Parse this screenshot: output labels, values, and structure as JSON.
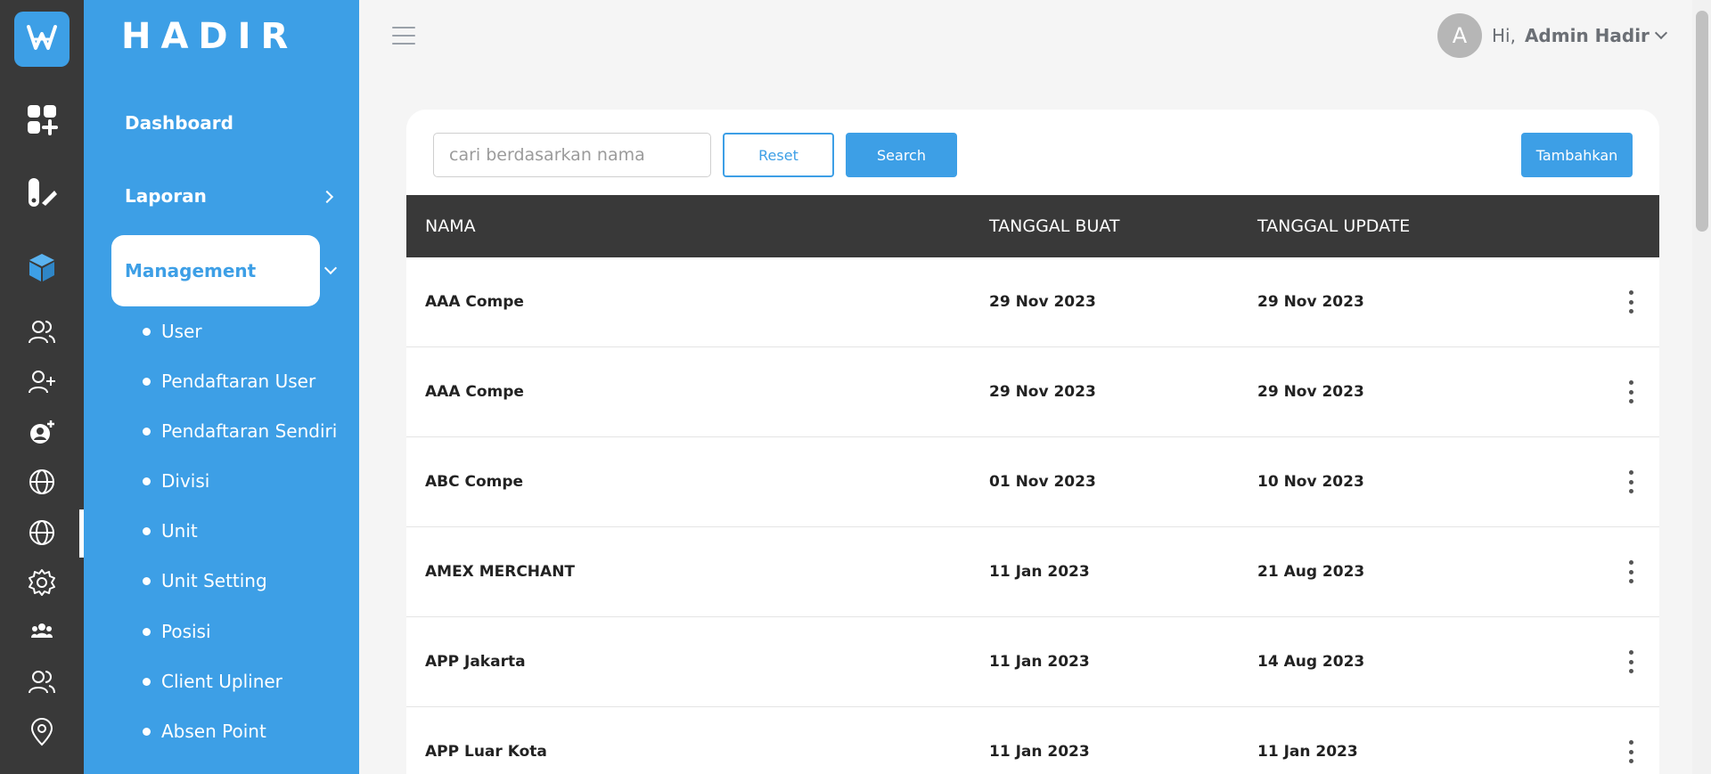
{
  "app": {
    "brand": "HADIR"
  },
  "sidebar": {
    "rail_icons": [
      "dashboard-icon",
      "report-icon",
      "cube-icon",
      "users-icon",
      "user-add-icon",
      "user-settings-icon",
      "globe-icon",
      "globe-icon",
      "gear-icon",
      "team-icon",
      "users-icon",
      "location-pin-icon"
    ],
    "menu": {
      "dashboard": "Dashboard",
      "laporan": "Laporan",
      "management": "Management",
      "sub_items": [
        "User",
        "Pendaftaran User",
        "Pendaftaran Sendiri",
        "Divisi",
        "Unit",
        "Unit Setting",
        "Posisi",
        "Client Upliner",
        "Absen Point"
      ]
    }
  },
  "header": {
    "avatar_letter": "A",
    "greeting": "Hi,",
    "user_name": "Admin Hadir"
  },
  "toolbar": {
    "search_placeholder": "cari berdasarkan nama",
    "reset_label": "Reset",
    "search_label": "Search",
    "add_label": "Tambahkan"
  },
  "table": {
    "columns": [
      "NAMA",
      "TANGGAL BUAT",
      "TANGGAL UPDATE"
    ],
    "rows": [
      {
        "nama": "AAA Compe",
        "tanggal_buat": "29 Nov 2023",
        "tanggal_update": "29 Nov 2023"
      },
      {
        "nama": "AAA Compe",
        "tanggal_buat": "29 Nov 2023",
        "tanggal_update": "29 Nov 2023"
      },
      {
        "nama": "ABC Compe",
        "tanggal_buat": "01 Nov 2023",
        "tanggal_update": "10 Nov 2023"
      },
      {
        "nama": "AMEX MERCHANT",
        "tanggal_buat": "11 Jan 2023",
        "tanggal_update": "21 Aug 2023"
      },
      {
        "nama": "APP Jakarta",
        "tanggal_buat": "11 Jan 2023",
        "tanggal_update": "14 Aug 2023"
      },
      {
        "nama": "APP Luar Kota",
        "tanggal_buat": "11 Jan 2023",
        "tanggal_update": "11 Jan 2023"
      }
    ]
  },
  "colors": {
    "primary": "#3d9fe6",
    "dark": "#393939",
    "background": "#f5f5f5"
  }
}
